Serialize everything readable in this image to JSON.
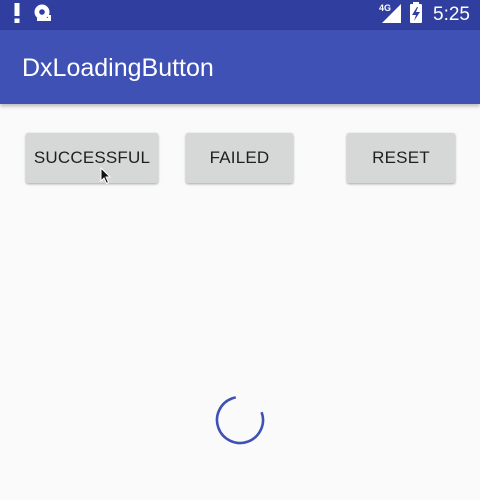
{
  "status_bar": {
    "network": "4G",
    "time": "5:25",
    "icons": [
      "alert-icon",
      "sync-icon",
      "signal-icon",
      "battery-charging-icon"
    ]
  },
  "app_bar": {
    "title": "DxLoadingButton"
  },
  "buttons": {
    "successful": "SUCCESSFUL",
    "failed": "FAILED",
    "reset": "RESET"
  },
  "colors": {
    "status_bar": "#303f9f",
    "app_bar": "#3f51b5",
    "button_bg": "#d6d7d7",
    "spinner": "#3f51b5",
    "background": "#fafafa"
  }
}
